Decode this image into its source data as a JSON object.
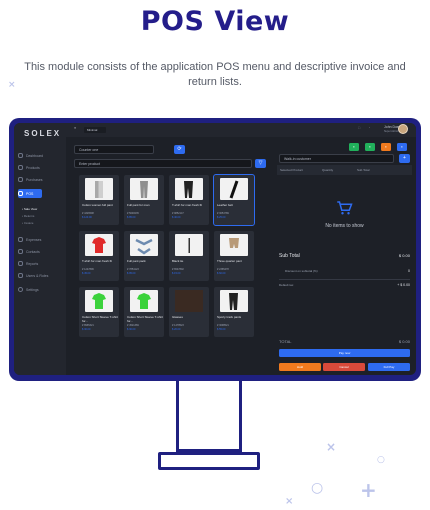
{
  "heading": {
    "title": "POS View",
    "subtitle": "This module consists of the application POS menu and descriptive invoice and return lists."
  },
  "colors": {
    "brand": "#1f2080",
    "accent": "#2e6bf0",
    "green": "#21b05b",
    "orange": "#f07a1e",
    "red": "#d94a3a",
    "screen_bg": "#1d2027"
  },
  "app": {
    "logo": "SOLEX",
    "topbar": {
      "menu_label": "≡",
      "search_value": "Minimal",
      "user_name": "John Doe",
      "user_role": "Super Admin"
    },
    "sidebar": {
      "items": [
        {
          "label": "Dashboard",
          "icon": "dashboard-icon"
        },
        {
          "label": "Products",
          "icon": "box-icon"
        },
        {
          "label": "Purchases",
          "icon": "cart-icon"
        },
        {
          "label": "POS",
          "icon": "pos-icon",
          "active": true
        },
        {
          "label": "Expenses",
          "icon": "expense-icon"
        },
        {
          "label": "Contacts",
          "icon": "contacts-icon"
        },
        {
          "label": "Reports",
          "icon": "report-icon"
        },
        {
          "label": "Users & Roles",
          "icon": "users-icon"
        },
        {
          "label": "Settings",
          "icon": "gear-icon"
        }
      ],
      "sub_items": [
        "Sale View",
        "Returns",
        "Invoice"
      ]
    },
    "products": {
      "counter_value": "Counter one",
      "search_placeholder": "Enter product",
      "items": [
        {
          "name": "Cotton women full pant",
          "sku": "# 4326598",
          "price": "$ 120.00"
        },
        {
          "name": "Full pant for man",
          "sku": "# 5648235",
          "price": "$ 85.00"
        },
        {
          "name": "T-shirt for man fresh fit",
          "sku": "# 9852147",
          "price": "$ 40.00"
        },
        {
          "name": "Leather belt",
          "sku": "# 3654789",
          "price": "$ 25.00"
        },
        {
          "name": "T-shirt for man fresh fit",
          "sku": "# 1247896",
          "price": "$ 45.00"
        },
        {
          "name": "Full pant pack",
          "sku": "# 7854123",
          "price": "$ 95.00"
        },
        {
          "name": "Black tie",
          "sku": "# 6547892",
          "price": "$ 15.00"
        },
        {
          "name": "Three quarter pant",
          "sku": "# 2365478",
          "price": "$ 60.00"
        },
        {
          "name": "Cotton Short Sleeve T-shirt for...",
          "sku": "# 8965321",
          "price": "$ 30.00"
        },
        {
          "name": "Cotton Short Sleeve T-shirt for...",
          "sku": "# 4521369",
          "price": "$ 30.00"
        },
        {
          "name": "Glasses",
          "sku": "# 1478523",
          "price": "$ 20.00"
        },
        {
          "name": "Sporty track pants",
          "sku": "# 3698521",
          "price": "$ 55.00"
        }
      ]
    },
    "cart": {
      "customer_value": "Walk-in customer",
      "columns": [
        "Selected Product",
        "Quantity",
        "Sub Total"
      ],
      "empty_text": "No items to show",
      "sub_total_label": "Sub Total",
      "sub_total_value": "$ 0.00",
      "discount_label": "Discount on subtotal (%)",
      "discount_value": "0",
      "tax_label": "Default tax",
      "tax_value": "+ $ 0.00",
      "total_label": "TOTAL",
      "total_value": "$ 0.00",
      "pay_label": "Pay now",
      "hold_label": "Hold",
      "cancel_label": "Cancel",
      "pay_full_label": "Full Pay"
    }
  }
}
